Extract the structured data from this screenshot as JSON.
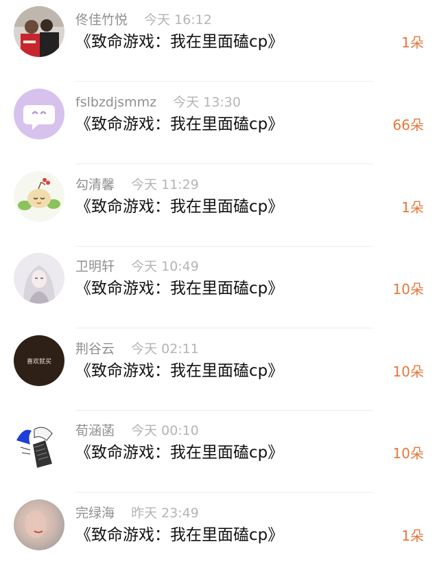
{
  "colors": {
    "count_accent": "#e8763a",
    "username": "#8f8f8f",
    "timestamp": "#b4b4b4",
    "title": "#111111"
  },
  "items": [
    {
      "username": "佟佳竹悦",
      "time": "今天 16:12",
      "title": "《致命游戏：我在里面磕cp》",
      "count": "1朵",
      "avatar_icon": "photo-couple-icon"
    },
    {
      "username": "fslbzdjsmmz",
      "time": "今天 13:30",
      "title": "《致命游戏：我在里面磕cp》",
      "count": "66朵",
      "avatar_icon": "chat-bubble-icon"
    },
    {
      "username": "勾清馨",
      "time": "今天 11:29",
      "title": "《致命游戏：我在里面磕cp》",
      "count": "1朵",
      "avatar_icon": "cartoon-character-icon"
    },
    {
      "username": "卫明轩",
      "time": "今天 10:49",
      "title": "《致命游戏：我在里面磕cp》",
      "count": "10朵",
      "avatar_icon": "anime-girl-icon"
    },
    {
      "username": "荆谷云",
      "time": "今天 02:11",
      "title": "《致命游戏：我在里面磕cp》",
      "count": "10朵",
      "avatar_icon": "text-badge-icon",
      "avatar_text": "喜欢就买"
    },
    {
      "username": "荀涵菡",
      "time": "今天 00:10",
      "title": "《致命游戏：我在里面磕cp》",
      "count": "10朵",
      "avatar_icon": "sketch-figure-icon"
    },
    {
      "username": "完绿海",
      "time": "昨天 23:49",
      "title": "《致命游戏：我在里面磕cp》",
      "count": "1朵",
      "avatar_icon": "blurred-portrait-icon"
    }
  ]
}
